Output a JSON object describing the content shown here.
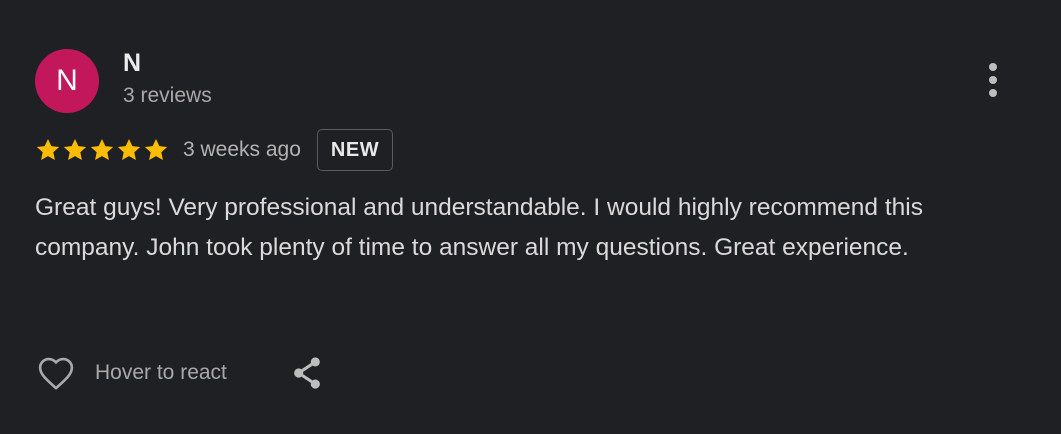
{
  "reviewer": {
    "initial": "N",
    "name": "N",
    "meta": "3 reviews",
    "avatar_color": "#c2185b"
  },
  "rating": {
    "stars": 5,
    "max": 5,
    "star_color": "#fbbc04"
  },
  "date": "3 weeks ago",
  "badge": "NEW",
  "review_text": "Great guys! Very professional and understandable. I would highly recommend this company. John took plenty of time to answer all my questions. Great experience.",
  "actions": {
    "react_label": "Hover to react",
    "heart_icon": "heart-outline-icon",
    "share_icon": "share-icon",
    "more_icon": "more-vertical-icon"
  }
}
